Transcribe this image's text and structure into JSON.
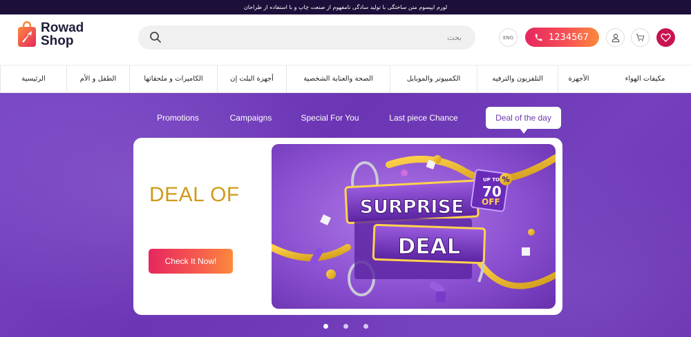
{
  "topbar": {
    "text": "لورم ایپسوم متن ساختگی با تولید سادگی نامفهوم از صنعت چاپ و با استفاده از طراحان"
  },
  "header": {
    "logo_line1": "Rowad",
    "logo_line2": "Shop",
    "search_placeholder": "بحث",
    "lang": "ENG",
    "phone": "1234567"
  },
  "nav": {
    "items": [
      "الرئيسية",
      "الطفل و الأم",
      "الكاميرات و ملحقاتها",
      "أجهزة البلت إن",
      "الصحة والعناية الشخصية",
      "الكمبيوتر والموبايل",
      "التلفزيون والترفيه",
      "الأجهزة",
      "مكيفات الهواء"
    ]
  },
  "hero": {
    "tabs": [
      "Deal of the day",
      "Last piece Chance",
      "Special For You",
      "Campaigns",
      "Promotions"
    ],
    "active_tab": "Deal of the day",
    "deal_title": "DEAL OF",
    "cta_label": "Check It Now!",
    "promo": {
      "line1": "SURPRISE",
      "line2": "DEAL",
      "badge_top": "UP TO",
      "badge_value": "70",
      "badge_percent": "%",
      "badge_bottom": "OFF"
    },
    "slide_count": 3,
    "active_slide": 1
  },
  "colors": {
    "brand_pink": "#e6275f",
    "brand_orange": "#fb8a3b",
    "hero_purple": "#6b35b3",
    "deal_gold": "#d09a1a",
    "heart": "#c8134f",
    "topbar": "#1c0f3a"
  },
  "icons": [
    "logo-bag-icon",
    "search-icon",
    "phone-icon",
    "user-icon",
    "cart-icon",
    "heart-icon"
  ]
}
